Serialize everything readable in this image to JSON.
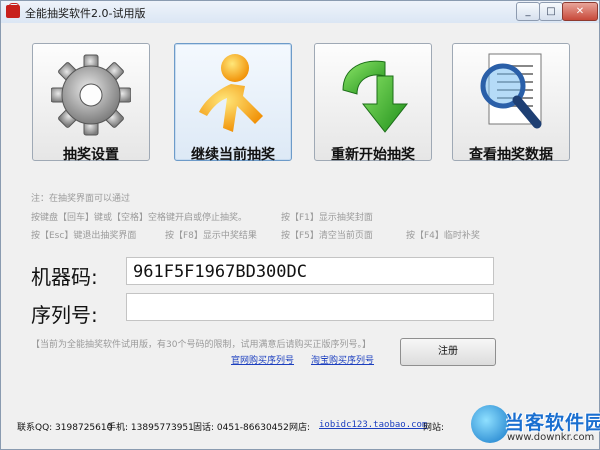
{
  "window": {
    "title": "全能抽奖软件2.0-试用版"
  },
  "titlebar_controls": {
    "minimize": "_",
    "maximize": "□",
    "close": "✕"
  },
  "big_buttons": [
    {
      "label": "抽奖设置",
      "icon": "gear-icon"
    },
    {
      "label": "继续当前抽奖",
      "icon": "running-man-icon"
    },
    {
      "label": "重新开始抽奖",
      "icon": "green-arrow-icon"
    },
    {
      "label": "查看抽奖数据",
      "icon": "magnifier-document-icon"
    }
  ],
  "hints": {
    "line1": "注：在抽奖界面可以通过",
    "line2a": "按键盘【回车】键或【空格】空格键开启或停止抽奖。",
    "line2b": "按【F1】显示抽奖封面",
    "line3a": "按【Esc】键退出抽奖界面",
    "line3b": "按【F8】显示中奖结果",
    "line3c": "按【F5】清空当前页面",
    "line3d": "按【F4】临时补奖"
  },
  "form": {
    "machine_code_label": "机器码:",
    "machine_code_value": "961F5F1967BD300DC",
    "serial_label": "序列号:",
    "serial_value": ""
  },
  "notice": "【当前为全能抽奖软件试用版，有30个号码的限制，试用满意后请购买正版序列号。】",
  "links": {
    "official": "官网购买序列号",
    "taobao": "淘宝购买序列号"
  },
  "register_button": "注册",
  "footer": {
    "qq": "联系QQ: 3198725610",
    "phone": "手机: 13895773951",
    "tel": "固话: 0451-86630452",
    "shop_label": "网店:",
    "shop_url": "iobidc123.taobao.com",
    "site_label": "网站:"
  },
  "watermark": {
    "name": "当客软件园",
    "url": "www.downkr.com"
  }
}
